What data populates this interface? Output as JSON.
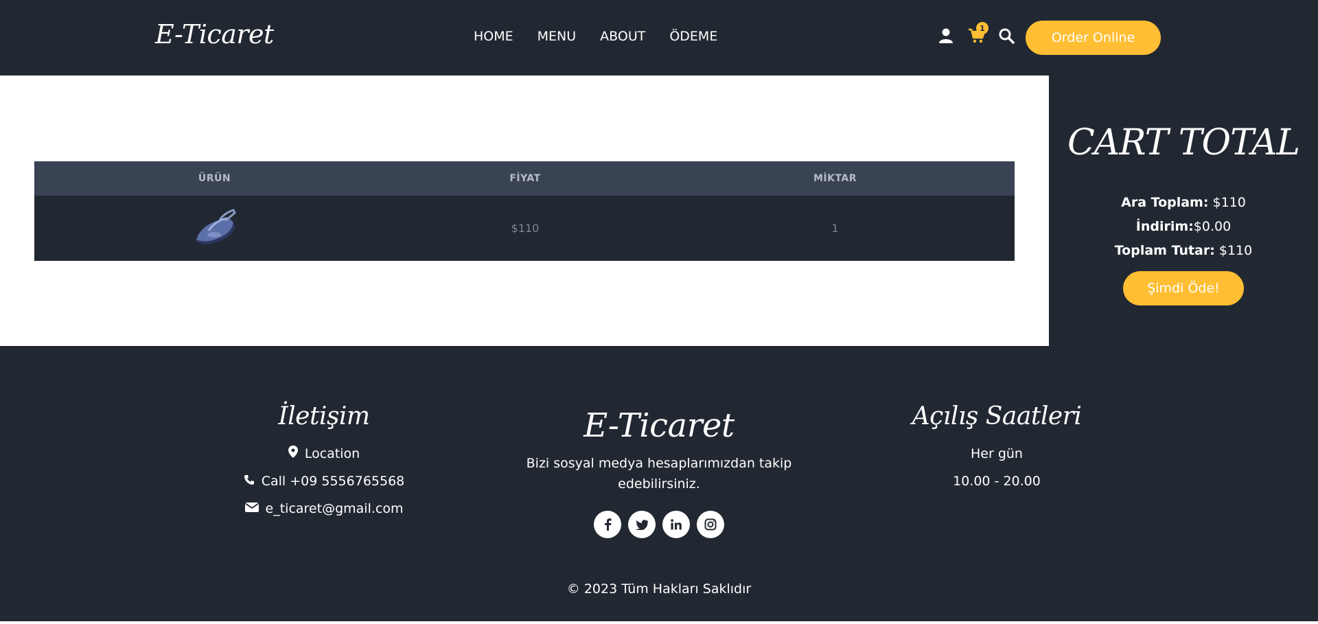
{
  "header": {
    "logo": "E-Ticaret",
    "nav": [
      "HOME",
      "MENU",
      "ABOUT",
      "ÖDEME"
    ],
    "cart_count": "1",
    "order_button": "Order Online",
    "icons": [
      "user-icon",
      "cart-icon",
      "search-icon"
    ]
  },
  "cart": {
    "headers": [
      "ÜRÜN",
      "FİYAT",
      "MİKTAR"
    ],
    "rows": [
      {
        "image": "iron-product-image",
        "price": "$110",
        "quantity": "1"
      }
    ]
  },
  "cart_total": {
    "title": "CART TOTAL",
    "subtotal_label": "Ara Toplam:",
    "subtotal_value": " $110",
    "discount_label": "İndirim:",
    "discount_value": "$0.00",
    "total_label": "Toplam Tutar:",
    "total_value": " $110",
    "pay_button": "Şimdi Öde!"
  },
  "footer": {
    "contact": {
      "title": "İletişim",
      "location": "Location",
      "phone": "Call +09 5556765568",
      "email": "e_ticaret@gmail.com"
    },
    "brand": {
      "title": "E-Ticaret",
      "text": "Bizi sosyal medya hesaplarımızdan takip edebilirsiniz.",
      "socials": [
        "facebook-icon",
        "twitter-icon",
        "linkedin-icon",
        "instagram-icon"
      ]
    },
    "hours": {
      "title": "Açılış Saatleri",
      "days": "Her gün",
      "time": "10.00 - 20.00"
    },
    "copyright": "© 2023 Tüm Hakları Saklıdır"
  },
  "colors": {
    "background": "#222831",
    "accent": "#ffbe33",
    "table_header": "#3a4354",
    "panel": "#ffffff"
  }
}
